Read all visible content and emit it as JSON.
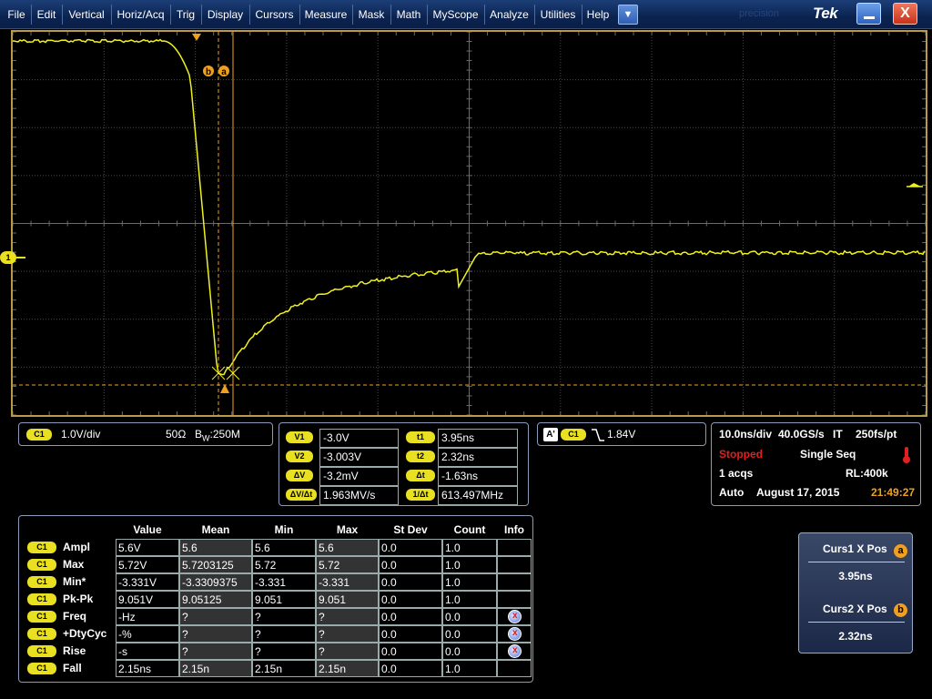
{
  "menu": {
    "items": [
      "File",
      "Edit",
      "Vertical",
      "Horiz/Acq",
      "Trig",
      "Display",
      "Cursors",
      "Measure",
      "Mask",
      "Math",
      "MyScope",
      "Analyze",
      "Utilities",
      "Help"
    ],
    "dropdown_icon": "chevron-down-icon",
    "brand": "Tek",
    "ghost_text": "precision",
    "close_glyph": "X"
  },
  "graticule": {
    "channel_marker": "1",
    "cursor_a_label": "a",
    "cursor_b_label": "b",
    "trace_color": "#f0f020",
    "cursor_color": "#f0a020"
  },
  "channel_panel": {
    "badge": "C1",
    "scale": "1.0V/div",
    "impedance": "50Ω",
    "bw_prefix": "B",
    "bw_sub": "W",
    "bw_value": ":250M"
  },
  "cursor_readout": {
    "rows": [
      {
        "label": "V1",
        "value": "-3.0V",
        "label2": "t1",
        "value2": "3.95ns"
      },
      {
        "label": "V2",
        "value": "-3.003V",
        "label2": "t2",
        "value2": "2.32ns"
      },
      {
        "label": "ΔV",
        "value": "-3.2mV",
        "label2": "Δt",
        "value2": "-1.63ns"
      },
      {
        "label": "ΔV/Δt",
        "value": "1.963MV/s",
        "label2": "1/Δt",
        "value2": "613.497MHz"
      }
    ]
  },
  "trigger_panel": {
    "a_badge": "A'",
    "source_badge": "C1",
    "slope_icon": "falling-edge-icon",
    "level": "1.84V"
  },
  "timebase_panel": {
    "scale": "10.0ns/div",
    "sample_rate": "40.0GS/s",
    "mode": "IT",
    "resolution": "250fs/pt",
    "status": "Stopped",
    "status_color": "#e02020",
    "seq": "Single Seq",
    "acqs": "1 acqs",
    "record_length": "RL:400k",
    "trigger_mode": "Auto",
    "date": "August 17, 2015",
    "time": "21:49:27",
    "time_color": "#f0a020",
    "temp_icon": "thermometer-icon"
  },
  "measurements": {
    "headers": [
      "Value",
      "Mean",
      "Min",
      "Max",
      "St Dev",
      "Count",
      "Info"
    ],
    "rows": [
      {
        "badge": "C1",
        "name": "Ampl",
        "value": "5.6V",
        "mean": "5.6",
        "min": "5.6",
        "max": "5.6",
        "stdev": "0.0",
        "count": "1.0",
        "info": false
      },
      {
        "badge": "C1",
        "name": "Max",
        "value": "5.72V",
        "mean": "5.7203125",
        "min": "5.72",
        "max": "5.72",
        "stdev": "0.0",
        "count": "1.0",
        "info": false
      },
      {
        "badge": "C1",
        "name": "Min*",
        "value": "-3.331V",
        "mean": "-3.3309375",
        "min": "-3.331",
        "max": "-3.331",
        "stdev": "0.0",
        "count": "1.0",
        "info": false
      },
      {
        "badge": "C1",
        "name": "Pk-Pk",
        "value": "9.051V",
        "mean": "9.05125",
        "min": "9.051",
        "max": "9.051",
        "stdev": "0.0",
        "count": "1.0",
        "info": false
      },
      {
        "badge": "C1",
        "name": "Freq",
        "value": "-Hz",
        "mean": "?",
        "min": "?",
        "max": "?",
        "stdev": "0.0",
        "count": "0.0",
        "info": true
      },
      {
        "badge": "C1",
        "name": "+DtyCyc",
        "value": "-%",
        "mean": "?",
        "min": "?",
        "max": "?",
        "stdev": "0.0",
        "count": "0.0",
        "info": true
      },
      {
        "badge": "C1",
        "name": "Rise",
        "value": "-s",
        "mean": "?",
        "min": "?",
        "max": "?",
        "stdev": "0.0",
        "count": "0.0",
        "info": true
      },
      {
        "badge": "C1",
        "name": "Fall",
        "value": "2.15ns",
        "mean": "2.15n",
        "min": "2.15n",
        "max": "2.15n",
        "stdev": "0.0",
        "count": "1.0",
        "info": false
      }
    ]
  },
  "cursor_pos": {
    "curs1_title": "Curs1 X Pos",
    "curs1_badge": "a",
    "curs1_value": "3.95ns",
    "curs2_title": "Curs2 X Pos",
    "curs2_badge": "b",
    "curs2_value": "2.32ns"
  }
}
